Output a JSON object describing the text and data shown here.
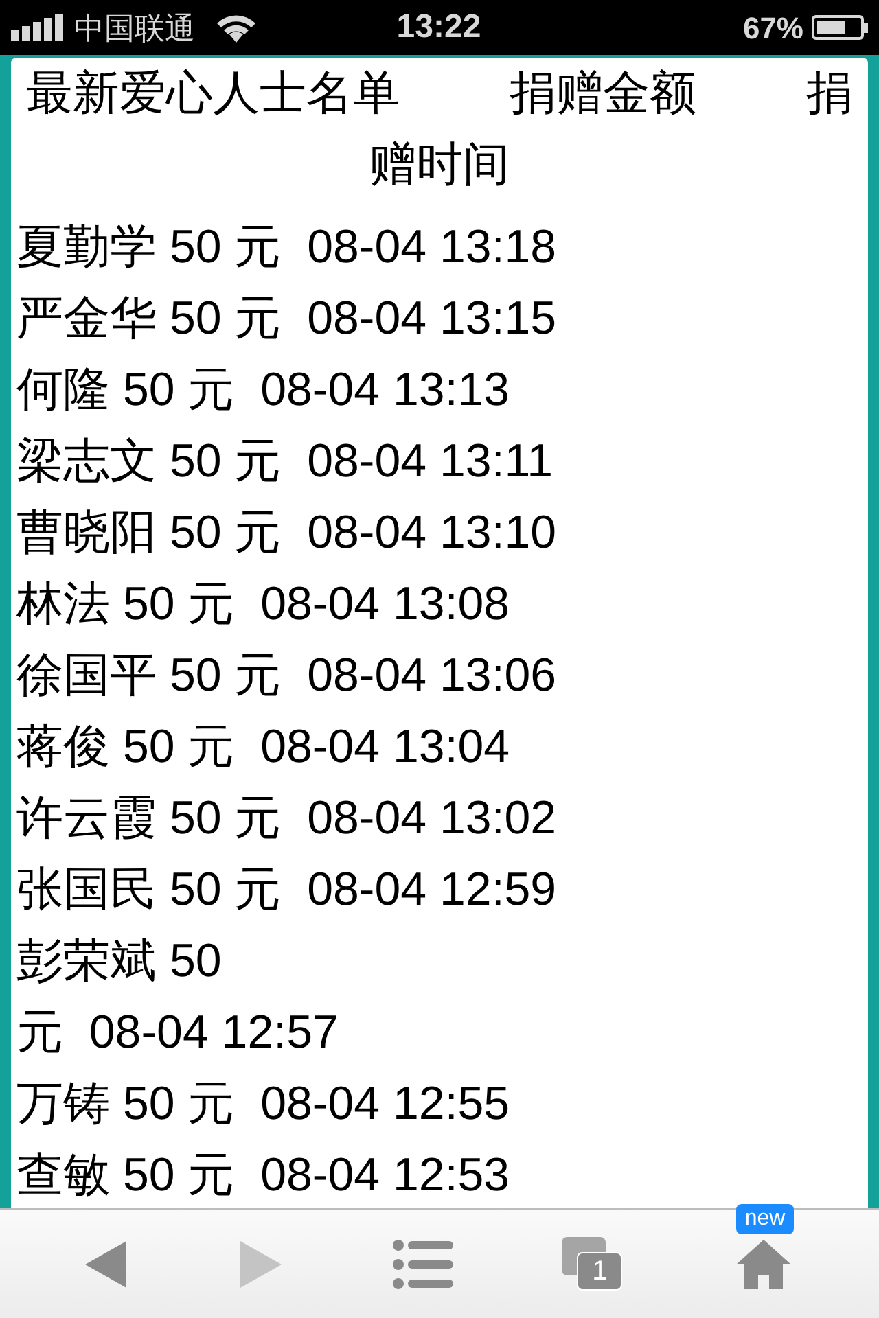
{
  "status_bar": {
    "carrier": "中国联通",
    "time": "13:22",
    "battery": {
      "reading": "67%",
      "level": 0.67
    }
  },
  "header": [
    "最新爱心人士名单",
    "捐赠金额",
    "捐赠时间"
  ],
  "lines": [
    "夏勤学 50 元  08-04 13:18",
    "严金华 50 元  08-04 13:15",
    "何隆 50 元  08-04 13:13",
    "梁志文 50 元  08-04 13:11",
    "曹晓阳 50 元  08-04 13:10",
    "林法 50 元  08-04 13:08",
    "徐国平 50 元  08-04 13:06",
    "蒋俊 50 元  08-04 13:04",
    "许云霞 50 元  08-04 13:02",
    "张国民 50 元  08-04 12:59",
    "彭荣斌 50",
    "元  08-04 12:57",
    "万铸 50 元  08-04 12:55",
    "查敏 50 元  08-04 12:53"
  ],
  "toolbar": {
    "back": {
      "disabled": false
    },
    "forward": {
      "disabled": true
    },
    "tabs_count": "1",
    "home_badge": "new"
  }
}
